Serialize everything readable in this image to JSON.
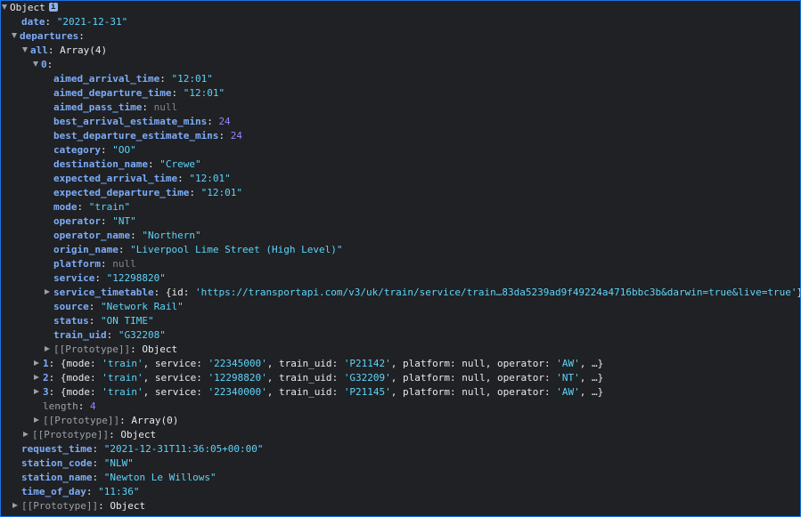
{
  "root": {
    "label": "Object",
    "info": "i"
  },
  "date": {
    "key": "date",
    "value": "\"2021-12-31\""
  },
  "departures": {
    "key": "departures"
  },
  "all": {
    "key": "all",
    "value": "Array(4)"
  },
  "item0": {
    "key": "0",
    "aimed_arrival_time": {
      "key": "aimed_arrival_time",
      "value": "\"12:01\""
    },
    "aimed_departure_time": {
      "key": "aimed_departure_time",
      "value": "\"12:01\""
    },
    "aimed_pass_time": {
      "key": "aimed_pass_time",
      "value": "null"
    },
    "best_arrival_estimate_mins": {
      "key": "best_arrival_estimate_mins",
      "value": "24"
    },
    "best_departure_estimate_mins": {
      "key": "best_departure_estimate_mins",
      "value": "24"
    },
    "category": {
      "key": "category",
      "value": "\"OO\""
    },
    "destination_name": {
      "key": "destination_name",
      "value": "\"Crewe\""
    },
    "expected_arrival_time": {
      "key": "expected_arrival_time",
      "value": "\"12:01\""
    },
    "expected_departure_time": {
      "key": "expected_departure_time",
      "value": "\"12:01\""
    },
    "mode": {
      "key": "mode",
      "value": "\"train\""
    },
    "operator": {
      "key": "operator",
      "value": "\"NT\""
    },
    "operator_name": {
      "key": "operator_name",
      "value": "\"Northern\""
    },
    "origin_name": {
      "key": "origin_name",
      "value": "\"Liverpool Lime Street (High Level)\""
    },
    "platform": {
      "key": "platform",
      "value": "null"
    },
    "service": {
      "key": "service",
      "value": "\"12298820\""
    },
    "service_timetable": {
      "key": "service_timetable",
      "prefix": "{id: ",
      "value": "'https://transportapi.com/v3/uk/train/service/train…83da5239ad9f49224a4716bbc3b&darwin=true&live=true'",
      "suffix": "}"
    },
    "source": {
      "key": "source",
      "value": "\"Network Rail\""
    },
    "status": {
      "key": "status",
      "value": "\"ON TIME\""
    },
    "train_uid": {
      "key": "train_uid",
      "value": "\"G32208\""
    },
    "prototype": {
      "key": "[[Prototype]]",
      "value": "Object"
    }
  },
  "item1": {
    "key": "1",
    "service": "'22345000'",
    "train_uid": "'P21142'",
    "operator": "'AW'"
  },
  "item2": {
    "key": "2",
    "service": "'12298820'",
    "train_uid": "'G32209'",
    "operator": "'NT'"
  },
  "item3": {
    "key": "3",
    "service": "'22340000'",
    "train_uid": "'P21145'",
    "operator": "'AW'"
  },
  "summary": {
    "open": "{",
    "mode_key": "mode",
    "mode_val": "'train'",
    "service_key": "service",
    "train_uid_key": "train_uid",
    "platform_key": "platform",
    "platform_val": "null",
    "operator_key": "operator",
    "colon": ": ",
    "comma": ", ",
    "tail": ", …}"
  },
  "length": {
    "key": "length",
    "value": "4"
  },
  "all_proto": {
    "key": "[[Prototype]]",
    "value": "Array(0)"
  },
  "departures_proto": {
    "key": "[[Prototype]]",
    "value": "Object"
  },
  "request_time": {
    "key": "request_time",
    "value": "\"2021-12-31T11:36:05+00:00\""
  },
  "station_code": {
    "key": "station_code",
    "value": "\"NLW\""
  },
  "station_name": {
    "key": "station_name",
    "value": "\"Newton Le Willows\""
  },
  "time_of_day": {
    "key": "time_of_day",
    "value": "\"11:36\""
  },
  "root_proto": {
    "key": "[[Prototype]]",
    "value": "Object"
  },
  "sep": ": "
}
